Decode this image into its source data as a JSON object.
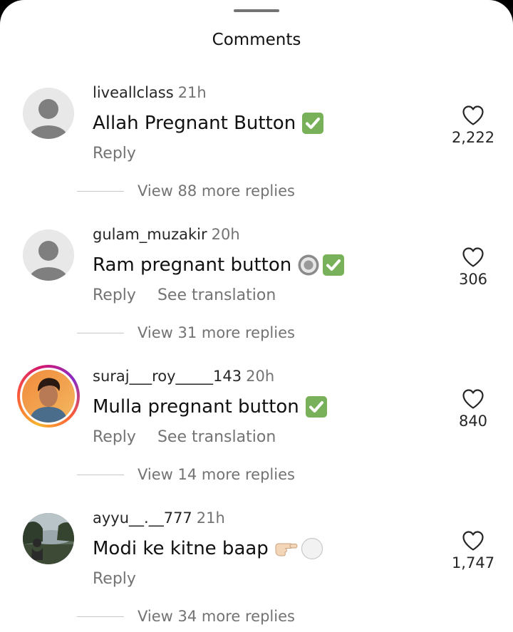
{
  "sheet": {
    "title": "Comments"
  },
  "comments": [
    {
      "username": "liveallclass",
      "time": "21h",
      "text": "Allah Pregnant Button",
      "emojis": [
        "check-mark-icon"
      ],
      "reply_label": "Reply",
      "like_count": "2,222",
      "replies_label": "View 88 more replies",
      "avatar": "default-avatar"
    },
    {
      "username": "gulam_muzakir",
      "time": "20h",
      "text": "Ram pregnant button",
      "emojis": [
        "radio-button-icon",
        "check-mark-icon"
      ],
      "reply_label": "Reply",
      "translation_label": "See translation",
      "like_count": "306",
      "replies_label": "View 31 more replies",
      "avatar": "default-avatar"
    },
    {
      "username": "suraj___roy_____143",
      "time": "20h",
      "text": "Mulla pregnant button",
      "emojis": [
        "check-mark-icon"
      ],
      "reply_label": "Reply",
      "translation_label": "See translation",
      "like_count": "840",
      "replies_label": "View 14 more replies",
      "avatar": "profile-photo-with-story-ring"
    },
    {
      "username": "ayyu__.__777",
      "time": "21h",
      "text": "Modi ke kitne baap",
      "emojis": [
        "pointing-right-hand-icon",
        "white-circle-icon"
      ],
      "reply_label": "Reply",
      "like_count": "1,747",
      "replies_label": "View 34 more replies",
      "avatar": "profile-photo-lake"
    }
  ],
  "colors": {
    "primary_text": "#262626",
    "secondary_text": "#737373",
    "check_green": "#78b159",
    "story_ring": "#d5186e"
  }
}
